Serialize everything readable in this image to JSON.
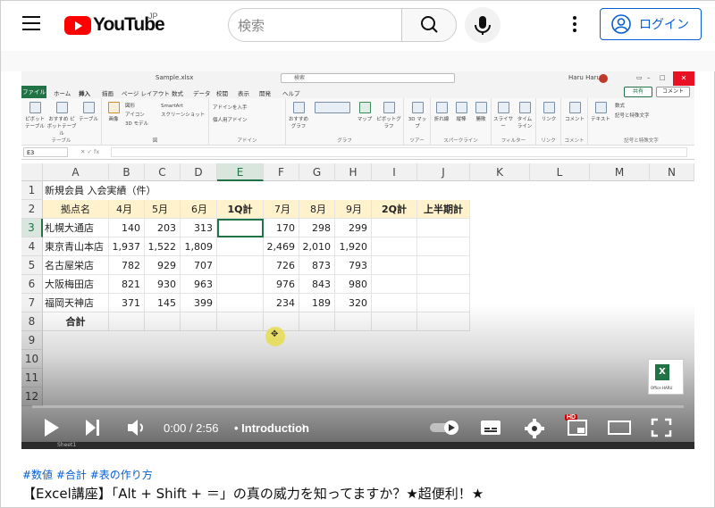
{
  "header": {
    "logo_text": "YouTube",
    "region": "JP",
    "search_placeholder": "検索",
    "login_label": "ログイン"
  },
  "excel": {
    "file_name": "Sample.xlsx",
    "search_placeholder": "検索",
    "user_name": "Haru Haru",
    "user_initials": "HH",
    "tabs": [
      "ファイル",
      "ホーム",
      "挿入",
      "描画",
      "ページ レイアウト",
      "数式",
      "データ",
      "校閲",
      "表示",
      "開発",
      "ヘルプ"
    ],
    "active_tab": "挿入",
    "share_label": "共有",
    "comment_label": "コメント",
    "ribbon_groups": [
      {
        "label": "テーブル",
        "items": [
          "ピボット テーブル",
          "おすすめ ピボットテーブル",
          "テーブル"
        ]
      },
      {
        "label": "図",
        "items": [
          "画像",
          "図形",
          "アイコン",
          "3D モデル",
          "SmartArt",
          "スクリーンショット"
        ]
      },
      {
        "label": "アドイン",
        "items": [
          "アドインを入手",
          "個人用アドイン"
        ]
      },
      {
        "label": "グラフ",
        "items": [
          "おすすめ グラフ",
          "マップ",
          "ピボットグラフ"
        ]
      },
      {
        "label": "ツアー",
        "items": [
          "3D マップ"
        ]
      },
      {
        "label": "スパークライン",
        "items": [
          "折れ線",
          "縦棒",
          "勝敗"
        ]
      },
      {
        "label": "フィルター",
        "items": [
          "スライサー",
          "タイム ライン"
        ]
      },
      {
        "label": "リンク",
        "items": [
          "リンク"
        ]
      },
      {
        "label": "コメント",
        "items": [
          "コメント"
        ]
      },
      {
        "label": "記号と特殊文字",
        "items": [
          "テキスト",
          "数式",
          "記号と特殊文字"
        ]
      }
    ],
    "name_box": "E3",
    "columns": [
      "A",
      "B",
      "C",
      "D",
      "E",
      "F",
      "G",
      "H",
      "I",
      "J",
      "K",
      "L",
      "M",
      "N"
    ],
    "selected_column": "E",
    "selected_row": "3",
    "sheet_title": "新規会員 入会実績（件）",
    "table_headers": [
      "拠点名",
      "4月",
      "5月",
      "6月",
      "1Q計",
      "7月",
      "8月",
      "9月",
      "2Q計",
      "上半期計"
    ],
    "rows": [
      {
        "num": "3",
        "name": "札幌大通店",
        "apr": "140",
        "may": "203",
        "jun": "313",
        "jul": "170",
        "aug": "298",
        "sep": "299"
      },
      {
        "num": "4",
        "name": "東京青山本店",
        "apr": "1,937",
        "may": "1,522",
        "jun": "1,809",
        "jul": "2,469",
        "aug": "2,010",
        "sep": "1,920"
      },
      {
        "num": "5",
        "name": "名古屋栄店",
        "apr": "782",
        "may": "929",
        "jun": "707",
        "jul": "726",
        "aug": "873",
        "sep": "793"
      },
      {
        "num": "6",
        "name": "大阪梅田店",
        "apr": "821",
        "may": "930",
        "jun": "963",
        "jul": "976",
        "aug": "843",
        "sep": "980"
      },
      {
        "num": "7",
        "name": "福岡天神店",
        "apr": "371",
        "may": "145",
        "jun": "399",
        "jul": "234",
        "aug": "189",
        "sep": "320"
      }
    ],
    "total_label": "合計",
    "row_numbers": [
      "1",
      "2",
      "3",
      "4",
      "5",
      "6",
      "7",
      "8",
      "9",
      "10",
      "11",
      "12"
    ],
    "sheet_tab": "Sheet1"
  },
  "player": {
    "time": "0:00 / 2:56",
    "chapter": "• Introduction",
    "progress": 0.0,
    "hd_badge": "HD",
    "overlay_logo_text": "Office HARU"
  },
  "video": {
    "hashtags": "#数値 #合計 #表の作り方",
    "title": "【Excel講座】「Alt + Shift + ＝」の真の威力を知ってますか？★超便利！★"
  }
}
